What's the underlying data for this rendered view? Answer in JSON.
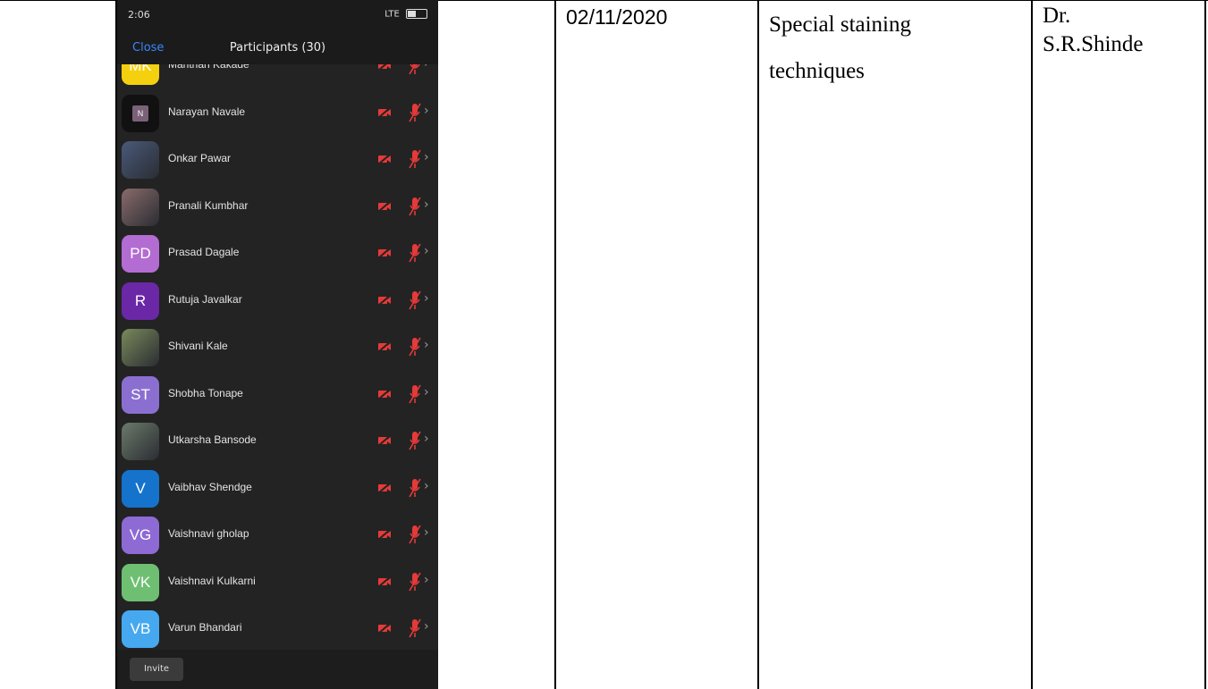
{
  "phone": {
    "status": {
      "time": "2:06",
      "right": "LTE"
    },
    "header": {
      "close": "Close",
      "title": "Participants (30)"
    },
    "participants": [
      {
        "name": "Manthan Kakade",
        "initials": "MK",
        "avatar_color": "#f5d00f",
        "kind": "initials"
      },
      {
        "name": "Narayan Navale",
        "initials": "N",
        "avatar_color": "#111111",
        "kind": "small-n"
      },
      {
        "name": "Onkar Pawar",
        "initials": "",
        "avatar_color": "#4a5a7a",
        "kind": "photo"
      },
      {
        "name": "Pranali Kumbhar",
        "initials": "",
        "avatar_color": "#8a6b6b",
        "kind": "photo"
      },
      {
        "name": "Prasad Dagale",
        "initials": "PD",
        "avatar_color": "#b36cd1",
        "kind": "initials"
      },
      {
        "name": "Rutuja Javalkar",
        "initials": "R",
        "avatar_color": "#6a27a6",
        "kind": "initials"
      },
      {
        "name": "Shivani Kale",
        "initials": "",
        "avatar_color": "#7a8a5a",
        "kind": "photo"
      },
      {
        "name": "Shobha Tonape",
        "initials": "ST",
        "avatar_color": "#8b6fd0",
        "kind": "initials"
      },
      {
        "name": "Utkarsha Bansode",
        "initials": "",
        "avatar_color": "#6b7a6a",
        "kind": "photo"
      },
      {
        "name": "Vaibhav Shendge",
        "initials": "V",
        "avatar_color": "#1673cc",
        "kind": "initials"
      },
      {
        "name": "Vaishnavi gholap",
        "initials": "VG",
        "avatar_color": "#8e6ad4",
        "kind": "initials"
      },
      {
        "name": "Vaishnavi Kulkarni",
        "initials": "VK",
        "avatar_color": "#6fbf73",
        "kind": "initials"
      },
      {
        "name": "Varun Bhandari",
        "initials": "VB",
        "avatar_color": "#46a9f0",
        "kind": "initials"
      }
    ],
    "footer": {
      "invite": "Invite"
    },
    "colors": {
      "muted_icon": "#e53a3a"
    }
  },
  "table_row": {
    "date": "02/11/2020",
    "topic_line1": "Special staining",
    "topic_line2": "techniques",
    "teacher_line1": "Dr.",
    "teacher_line2": "S.R.Shinde"
  }
}
